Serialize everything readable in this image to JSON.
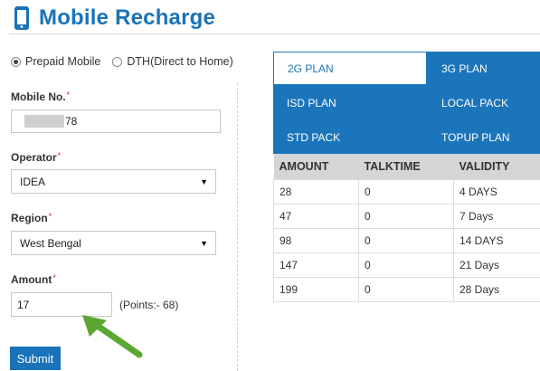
{
  "header": {
    "title": "Mobile Recharge",
    "icon": "mobile-phone-icon"
  },
  "recharge_type": {
    "options": [
      {
        "label": "Prepaid Mobile",
        "selected": true
      },
      {
        "label": "DTH(Direct to Home)",
        "selected": false
      }
    ]
  },
  "form": {
    "mobile": {
      "label": "Mobile No.",
      "required_mark": "*",
      "value_suffix": "78"
    },
    "operator": {
      "label": "Operator",
      "required_mark": "*",
      "value": "IDEA"
    },
    "region": {
      "label": "Region",
      "required_mark": "*",
      "value": "West Bengal"
    },
    "amount": {
      "label": "Amount",
      "required_mark": "*",
      "value": "17",
      "points_text": "(Points:- 68)"
    },
    "submit_label": "Submit"
  },
  "plans": {
    "tabs": [
      {
        "label": "2G PLAN",
        "active": true
      },
      {
        "label": "3G PLAN",
        "active": false
      },
      {
        "label": "ISD PLAN",
        "active": false
      },
      {
        "label": "LOCAL PACK",
        "active": false
      },
      {
        "label": "STD PACK",
        "active": false
      },
      {
        "label": "TOPUP PLAN",
        "active": false
      }
    ],
    "table": {
      "headers": [
        "AMOUNT",
        "TALKTIME",
        "VALIDITY"
      ],
      "rows": [
        [
          "28",
          "0",
          "4 DAYS"
        ],
        [
          "47",
          "0",
          "7 Days"
        ],
        [
          "98",
          "0",
          "14 DAYS"
        ],
        [
          "147",
          "0",
          "21 Days"
        ],
        [
          "199",
          "0",
          "28 Days"
        ]
      ]
    }
  },
  "colors": {
    "accent": "#1a73b8",
    "required": "#d9251c",
    "arrow": "#5aa832"
  }
}
